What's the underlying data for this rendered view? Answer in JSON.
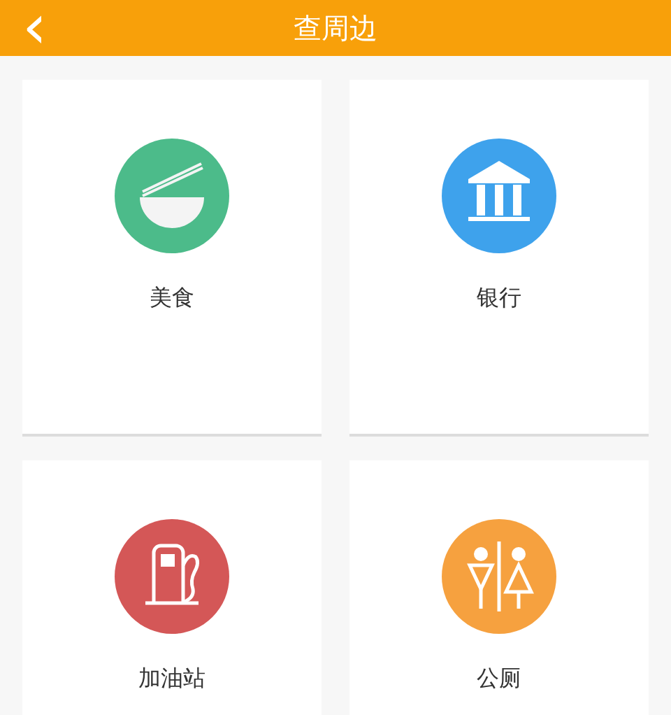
{
  "header": {
    "back_icon": "‹",
    "title": "查周边"
  },
  "categories": [
    {
      "label": "美食",
      "kind": "food",
      "color": "#4cbb8a"
    },
    {
      "label": "银行",
      "kind": "bank",
      "color": "#3ea2ec"
    },
    {
      "label": "加油站",
      "kind": "fuel",
      "color": "#d45757"
    },
    {
      "label": "公厕",
      "kind": "toilet",
      "color": "#f6a13f"
    }
  ]
}
